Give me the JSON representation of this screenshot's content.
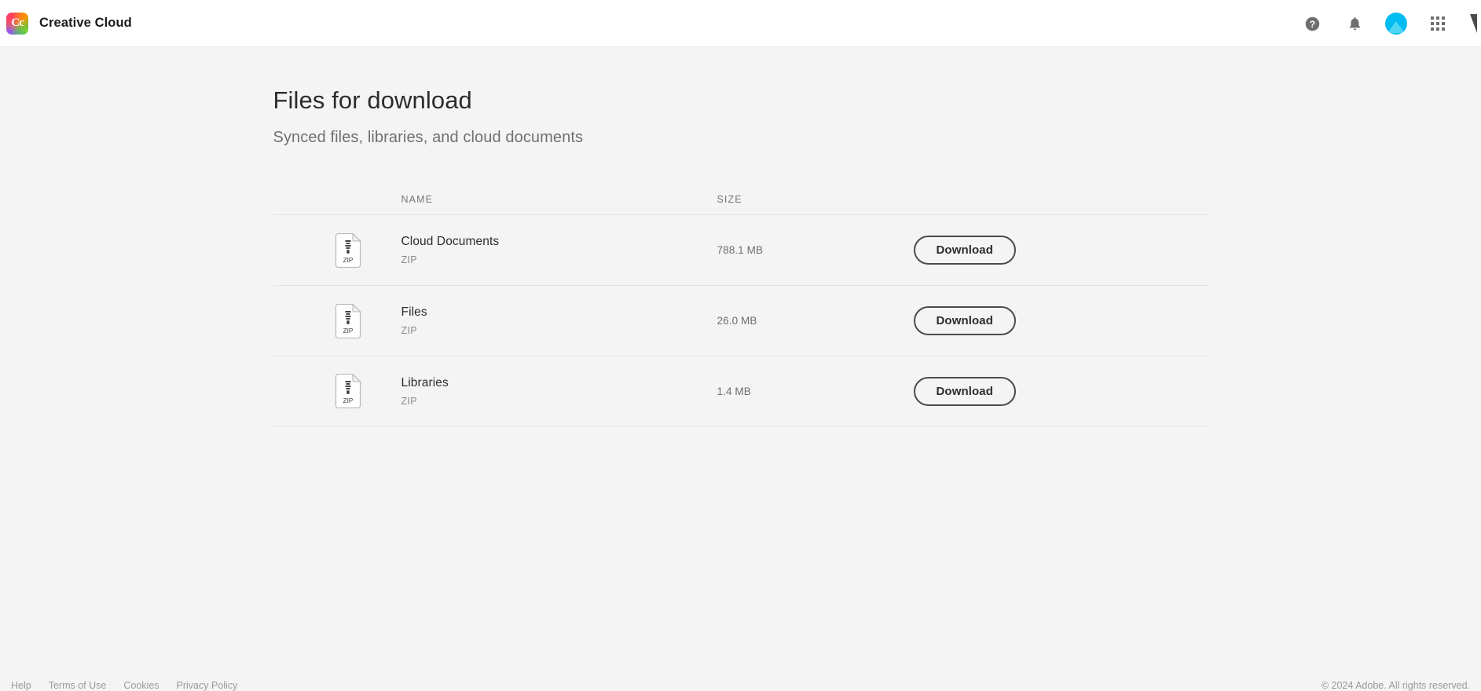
{
  "topbar": {
    "brand_title": "Creative Cloud",
    "logo_mark": "Cc",
    "icons": {
      "help": "help-icon",
      "notifications": "bell-icon",
      "avatar": "avatar",
      "app_grid": "app-grid-icon",
      "adobe": "adobe-logo"
    }
  },
  "page": {
    "title": "Files for download",
    "subtitle": "Synced files, libraries, and cloud documents"
  },
  "table": {
    "headers": {
      "name": "NAME",
      "size": "SIZE"
    },
    "rows": [
      {
        "icon_label": "ZIP",
        "name": "Cloud Documents",
        "type": "ZIP",
        "size": "788.1 MB",
        "action_label": "Download"
      },
      {
        "icon_label": "ZIP",
        "name": "Files",
        "type": "ZIP",
        "size": "26.0 MB",
        "action_label": "Download"
      },
      {
        "icon_label": "ZIP",
        "name": "Libraries",
        "type": "ZIP",
        "size": "1.4 MB",
        "action_label": "Download"
      }
    ]
  },
  "footer": {
    "links": [
      "Help",
      "Terms of Use",
      "Cookies",
      "Privacy Policy"
    ],
    "copyright": "© 2024 Adobe. All rights reserved."
  },
  "colors": {
    "page_background": "#f4f4f4",
    "topbar_background": "#ffffff",
    "avatar": "#00bcf0",
    "button_border": "#4b4b4b",
    "divider": "#e4e4e4"
  }
}
